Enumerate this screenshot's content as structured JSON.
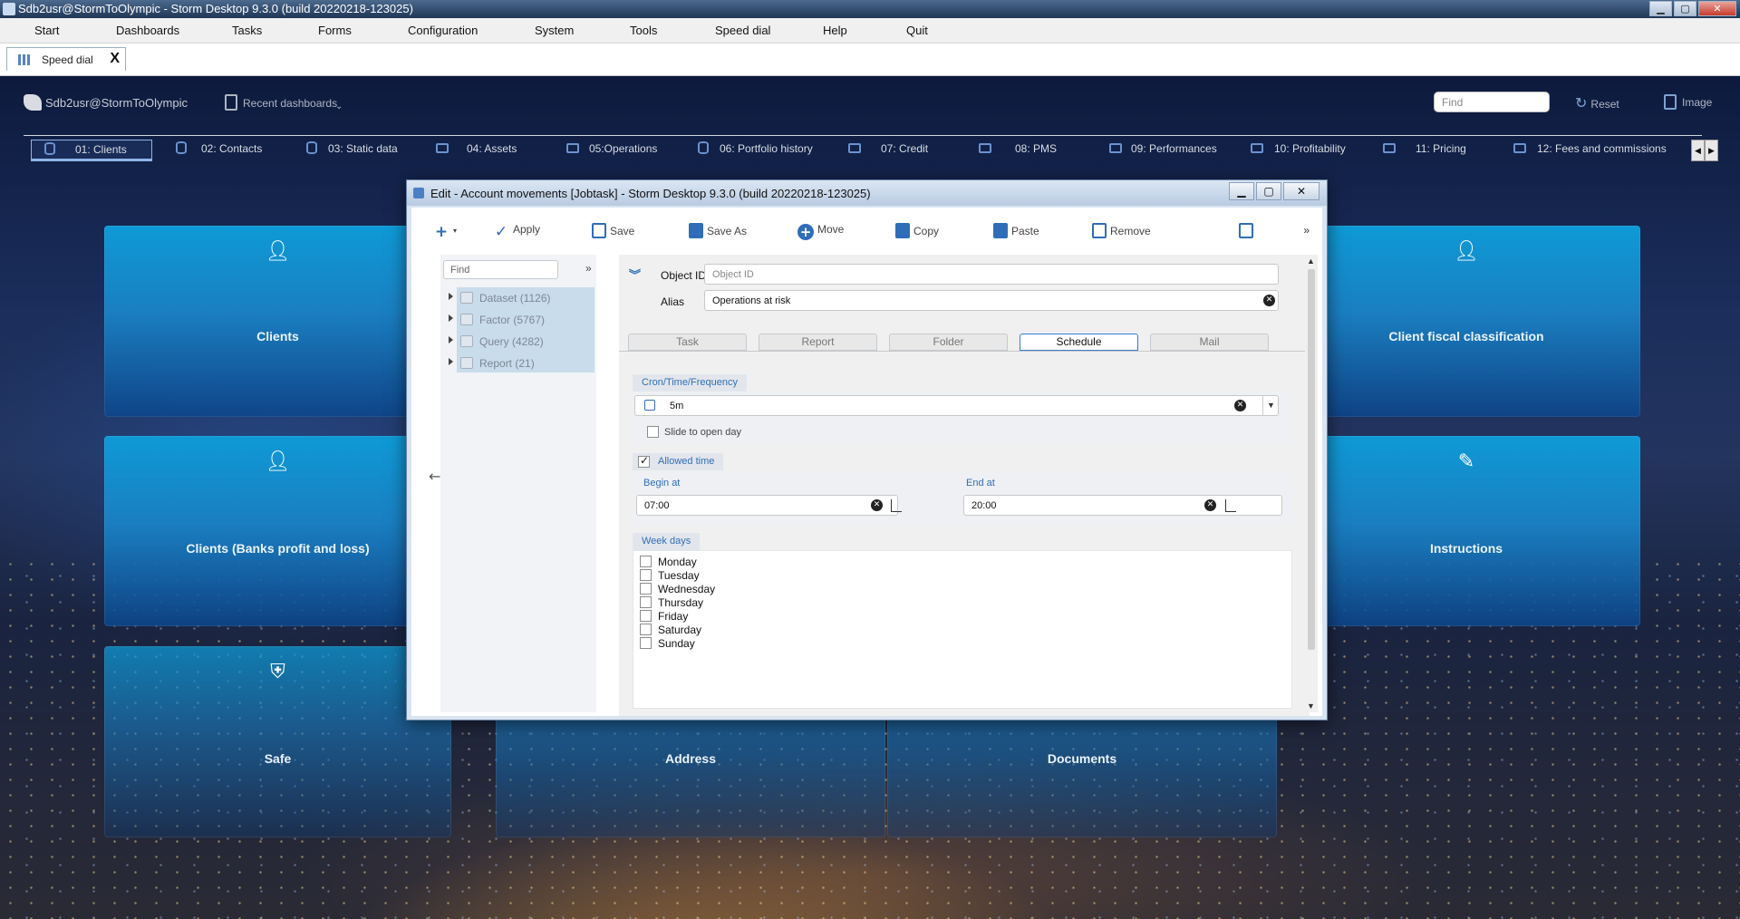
{
  "window": {
    "title": "Sdb2usr@StormToOlympic - Storm Desktop 9.3.0 (build 20220218-123025)"
  },
  "menu": [
    "Start",
    "Dashboards",
    "Tasks",
    "Forms",
    "Configuration",
    "System",
    "Tools",
    "Speed dial",
    "Help",
    "Quit"
  ],
  "doc_tab": {
    "label": "Speed dial",
    "close": "X"
  },
  "header": {
    "user": "Sdb2usr@StormToOlympic",
    "recent": "Recent dashboards",
    "find_placeholder": "Find",
    "reset": "Reset",
    "image": "Image"
  },
  "dashboard_tabs": [
    {
      "label": "01: Clients",
      "icon": "database-icon"
    },
    {
      "label": "02: Contacts",
      "icon": "database-icon"
    },
    {
      "label": "03: Static data",
      "icon": "database-icon"
    },
    {
      "label": "04: Assets",
      "icon": "asset-icon"
    },
    {
      "label": "05:Operations",
      "icon": "bank-icon"
    },
    {
      "label": "06: Portfolio history",
      "icon": "history-icon"
    },
    {
      "label": "07: Credit",
      "icon": "asset-icon"
    },
    {
      "label": "08: PMS",
      "icon": "chart-icon"
    },
    {
      "label": "09: Performances",
      "icon": "chart-icon"
    },
    {
      "label": "10: Profitability",
      "icon": "asset-icon"
    },
    {
      "label": "11: Pricing",
      "icon": "asset-icon"
    },
    {
      "label": "12: Fees and commissions",
      "icon": "asset-icon"
    }
  ],
  "tiles": [
    {
      "label": "Clients",
      "icon": "user-icon"
    },
    {
      "label": "Client fiscal classification",
      "icon": "user-edit-icon"
    },
    {
      "label": "Clients (Banks profit and loss)",
      "icon": "user-add-icon"
    },
    {
      "label": "Instructions",
      "icon": "pen-icon"
    },
    {
      "label": "Safe",
      "icon": "shield-icon"
    },
    {
      "label": "Address",
      "icon": ""
    },
    {
      "label": "Documents",
      "icon": ""
    }
  ],
  "dialog": {
    "title": "Edit - Account movements [Jobtask] -  Storm Desktop 9.3.0 (build 20220218-123025)",
    "toolbar": {
      "apply": "Apply",
      "save": "Save",
      "save_as": "Save As",
      "move": "Move",
      "copy": "Copy",
      "paste": "Paste",
      "remove": "Remove",
      "more": "»"
    },
    "tree": {
      "find_placeholder": "Find",
      "collapse": "»",
      "items": [
        "Dataset (1126)",
        "Factor (5767)",
        "Query (4282)",
        "Report (21)"
      ]
    },
    "form": {
      "object_id_label": "Object ID",
      "object_id_placeholder": "Object ID",
      "alias_label": "Alias",
      "alias_value": "Operations at risk",
      "tabs": [
        "Task",
        "Report",
        "Folder",
        "Schedule",
        "Mail"
      ],
      "active_tab": "Schedule",
      "cron_title": "Cron/Time/Frequency",
      "cron_value": "5m",
      "slide_label": "Slide to open day",
      "allowed_time_label": "Allowed time",
      "begin_label": "Begin at",
      "begin_value": "07:00",
      "end_label": "End at",
      "end_value": "20:00",
      "weekdays_title": "Week days",
      "weekdays": [
        "Monday",
        "Tuesday",
        "Wednesday",
        "Thursday",
        "Friday",
        "Saturday",
        "Sunday"
      ]
    }
  }
}
